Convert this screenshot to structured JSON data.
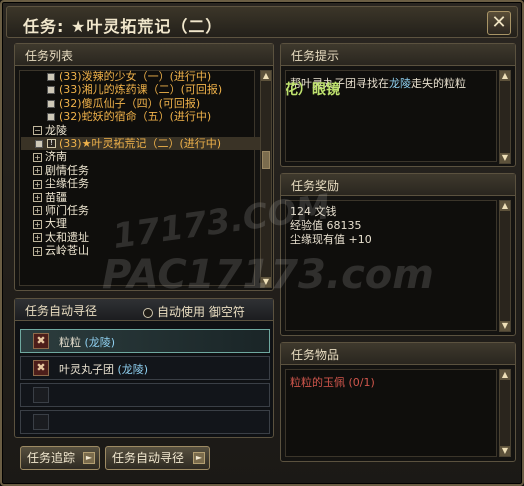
{
  "window": {
    "title": "任务: ★叶灵拓荒记（二）",
    "close_glyph": "✕"
  },
  "task_list": {
    "header": "任务列表",
    "rows": [
      {
        "type": "sub",
        "text": "(33)泼辣的少女（一）(进行中)"
      },
      {
        "type": "sub",
        "text": "(33)湘儿的炼药课（二）(可回报)"
      },
      {
        "type": "sub",
        "text": "(32)傻瓜仙子（四）(可回报)"
      },
      {
        "type": "sub",
        "text": "(32)蛇妖的宿命（五）(进行中)"
      },
      {
        "type": "cat",
        "text": "龙陵",
        "exp": "−"
      },
      {
        "type": "sel",
        "text": "(33)★叶灵拓荒记（二）(进行中)"
      },
      {
        "type": "cat",
        "text": "济南",
        "exp": "+"
      },
      {
        "type": "cat",
        "text": "剧情任务",
        "exp": "+"
      },
      {
        "type": "cat",
        "text": "尘缘任务",
        "exp": "+"
      },
      {
        "type": "cat",
        "text": "苗疆",
        "exp": "+"
      },
      {
        "type": "cat",
        "text": "师门任务",
        "exp": "+"
      },
      {
        "type": "cat",
        "text": "大理",
        "exp": "+"
      },
      {
        "type": "cat",
        "text": "太和遗址",
        "exp": "+"
      },
      {
        "type": "cat",
        "text": "云岭苍山",
        "exp": "+"
      }
    ]
  },
  "auto_path": {
    "header": "任务自动寻径",
    "auto_use_label": "自动使用 御空符",
    "entries": [
      {
        "name": "粒粒",
        "loc": "(龙陵)"
      },
      {
        "name": "叶灵丸子团",
        "loc": "(龙陵)"
      }
    ]
  },
  "buttons": {
    "track": "任务追踪",
    "auto_path": "任务自动寻径"
  },
  "hint": {
    "header": "任务提示",
    "text_pre": "帮叶灵丸子团寻找在",
    "loc": "龙陵",
    "text_post": "走失的粒粒",
    "overlay": "御灵（犬花花）眼镜"
  },
  "reward": {
    "header": "任务奖励",
    "lines": [
      "124 文钱",
      "经验值 68135",
      "尘缘现有值 +10"
    ]
  },
  "items": {
    "header": "任务物品",
    "text": "粒粒的玉佩 (0/1)"
  },
  "watermarks": {
    "a": "17173.COM",
    "b": "PAC17173.com"
  },
  "colors": {
    "accent": "#f0b24a",
    "location": "#8fd0f0",
    "item": "#d0564c"
  }
}
